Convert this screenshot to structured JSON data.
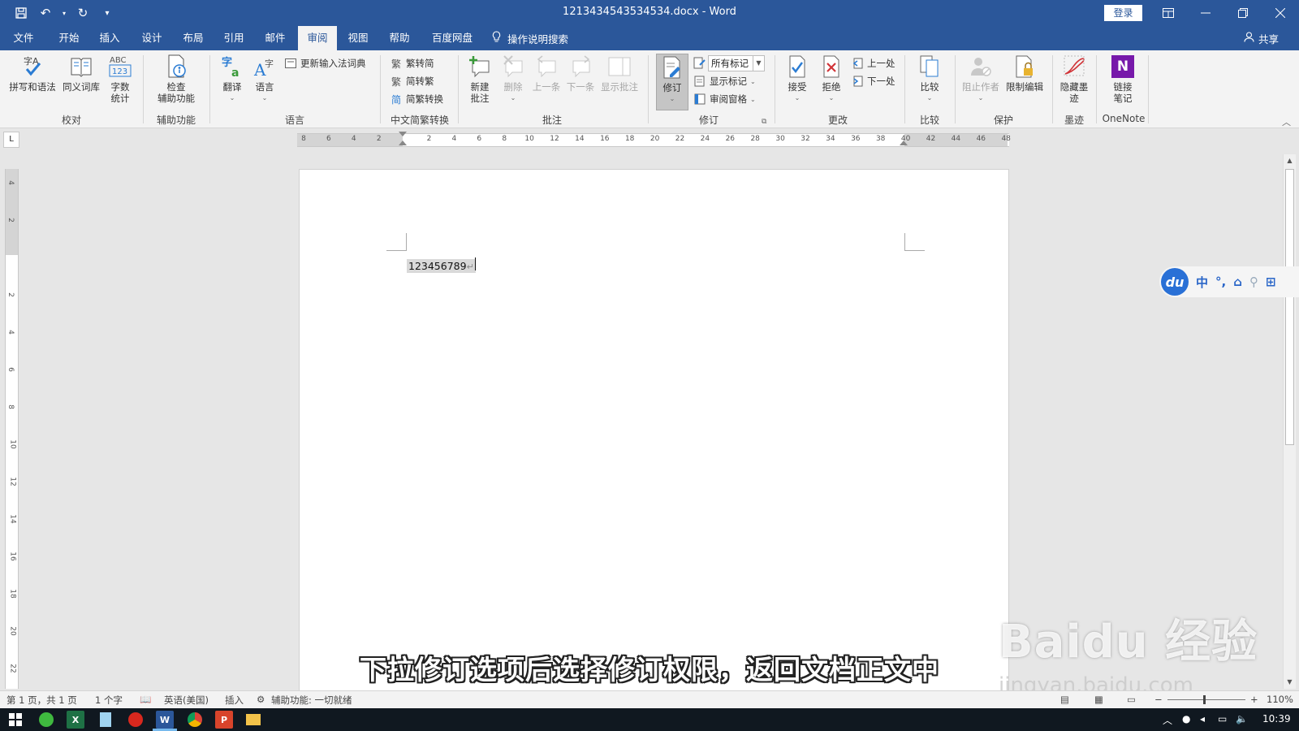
{
  "titlebar": {
    "title": "1213434543534534.docx  -  Word",
    "login": "登录",
    "colors": {
      "accent": "#2b579a"
    }
  },
  "menu": {
    "tabs": [
      "文件",
      "开始",
      "插入",
      "设计",
      "布局",
      "引用",
      "邮件",
      "审阅",
      "视图",
      "帮助",
      "百度网盘"
    ],
    "active": "审阅",
    "tell_me": "操作说明搜索",
    "share": "共享"
  },
  "ribbon": {
    "proofing": {
      "label": "校对",
      "spelling": "拼写和语法",
      "thesaurus": "同义词库",
      "wordcount_icon_text": "ABC\n123",
      "wordcount": "字数\n统计"
    },
    "accessibility": {
      "label": "辅助功能",
      "check": "检查\n辅助功能"
    },
    "language": {
      "label": "语言",
      "translate": "翻译",
      "language": "语言",
      "update_ime": "更新输入法词典"
    },
    "chinese_conversion": {
      "label": "中文简繁转换",
      "to_simplified": "繁转简",
      "to_traditional": "简转繁",
      "convert": "简繁转换"
    },
    "comments": {
      "label": "批注",
      "new": "新建\n批注",
      "delete": "删除",
      "previous": "上一条",
      "next": "下一条",
      "show": "显示批注"
    },
    "tracking": {
      "label": "修订",
      "track": "修订",
      "markup_value": "所有标记",
      "show_markup": "显示标记",
      "review_pane": "审阅窗格"
    },
    "changes": {
      "label": "更改",
      "accept": "接受",
      "reject": "拒绝",
      "previous": "上一处",
      "next": "下一处"
    },
    "compare": {
      "label": "比较",
      "compare": "比较"
    },
    "protect": {
      "label": "保护",
      "block_authors": "阻止作者",
      "restrict": "限制编辑"
    },
    "ink": {
      "label": "墨迹",
      "hide_ink": "隐藏墨\n迹"
    },
    "onenote": {
      "label": "OneNote",
      "linked_notes": "链接\n笔记",
      "icon_letter": "N"
    }
  },
  "rulers": {
    "corner": "L",
    "horizontal": [
      "8",
      "6",
      "4",
      "2",
      "",
      "2",
      "4",
      "6",
      "8",
      "10",
      "12",
      "14",
      "16",
      "18",
      "20",
      "22",
      "24",
      "26",
      "28",
      "30",
      "32",
      "34",
      "36",
      "38",
      "40",
      "42",
      "44",
      "46",
      "48"
    ],
    "vertical": [
      "4",
      "2",
      "",
      "2",
      "4",
      "6",
      "8",
      "10",
      "12",
      "14",
      "16",
      "18",
      "20",
      "22"
    ]
  },
  "document": {
    "text": "123456789",
    "para_mark": "↵"
  },
  "ime": {
    "logo": "du",
    "items": [
      "中",
      "°,",
      "⌂",
      "⚲",
      "⊞"
    ]
  },
  "subtitle": "下拉修订选项后选择修订权限，返回文档正文中",
  "watermark": {
    "main": "Baidu 经验",
    "sub": "jingyan.baidu.com"
  },
  "statusbar": {
    "page": "第 1 页，共 1 页",
    "words": "1 个字",
    "language": "英语(美国)",
    "mode": "插入",
    "accessibility": "辅助功能: 一切就绪",
    "zoom": "110%"
  },
  "taskbar": {
    "time": "10:39",
    "apps": [
      "excel",
      "notepad",
      "netease-music",
      "word",
      "chrome",
      "wps",
      "explorer"
    ]
  }
}
